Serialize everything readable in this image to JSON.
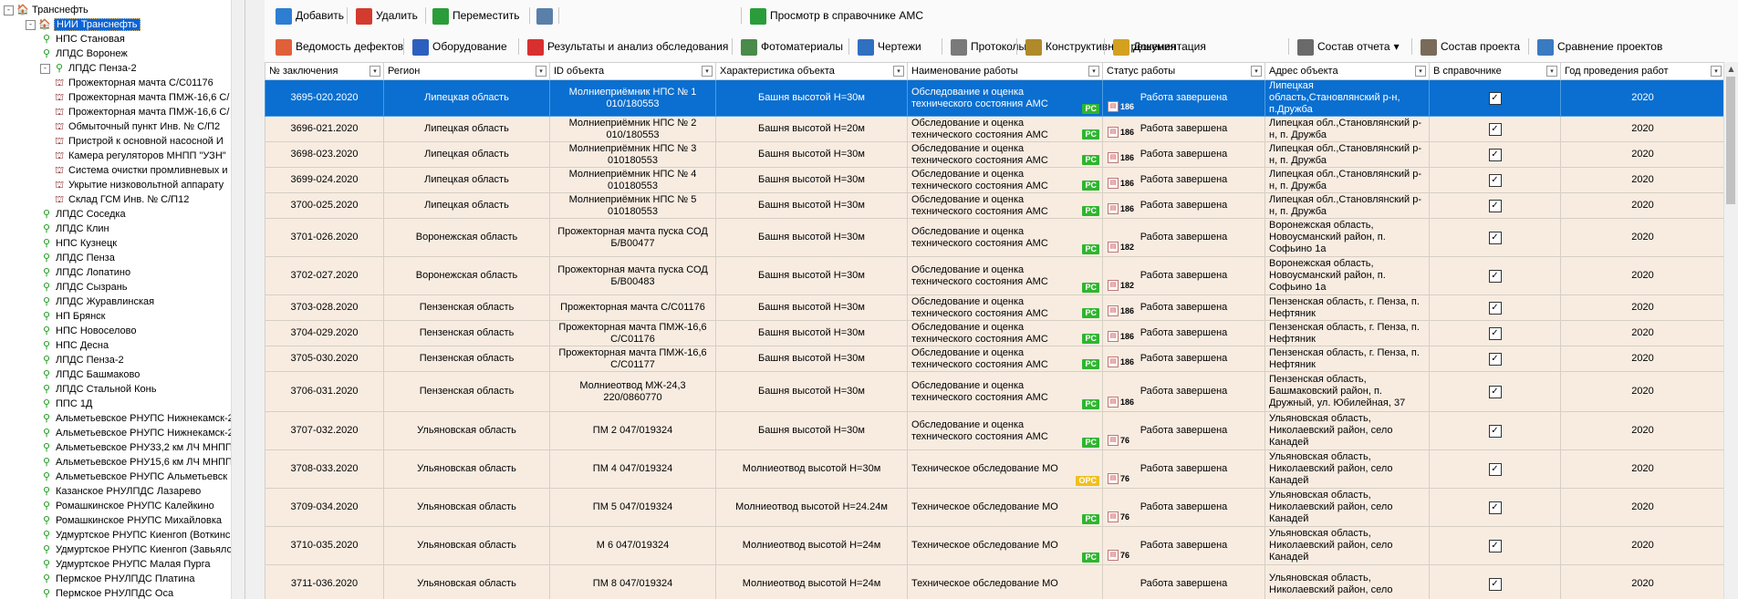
{
  "tree": {
    "items": [
      {
        "label": "Транснефть",
        "level": 0,
        "icon": "building",
        "expander": "-"
      },
      {
        "label": "НИИ Транснефть",
        "level": 1,
        "icon": "building",
        "expander": "-",
        "selected": true
      },
      {
        "label": "НПС Становая",
        "level": 2,
        "icon": "pin"
      },
      {
        "label": "ЛПДС Воронеж",
        "level": 2,
        "icon": "pin"
      },
      {
        "label": "ЛПДС Пенза-2",
        "level": 2,
        "icon": "pin",
        "expander": "-"
      },
      {
        "label": "Прожекторная мачта С/С01176",
        "level": 3,
        "icon": "tower"
      },
      {
        "label": "Прожекторная мачта ПМЖ-16,6 С/",
        "level": 3,
        "icon": "tower"
      },
      {
        "label": "Прожекторная мачта ПМЖ-16,6 С/",
        "level": 3,
        "icon": "tower"
      },
      {
        "label": "Обмыточный пункт   Инв. № С/П2",
        "level": 3,
        "icon": "tower"
      },
      {
        "label": "Пристрой к основной насосной   И",
        "level": 3,
        "icon": "tower"
      },
      {
        "label": "Камера регуляторов МНПП \"УЗН\"",
        "level": 3,
        "icon": "tower"
      },
      {
        "label": "Система очистки промливневых и (",
        "level": 3,
        "icon": "tower"
      },
      {
        "label": "Укрытие низковольтной аппарату",
        "level": 3,
        "icon": "tower"
      },
      {
        "label": "Склад  ГСМ  Инв. № С/П12",
        "level": 3,
        "icon": "tower"
      },
      {
        "label": "ЛПДС Соседка",
        "level": 2,
        "icon": "pin"
      },
      {
        "label": "ЛПДС Клин",
        "level": 2,
        "icon": "pin"
      },
      {
        "label": "НПС Кузнецк",
        "level": 2,
        "icon": "pin"
      },
      {
        "label": "ЛПДС Пенза",
        "level": 2,
        "icon": "pin"
      },
      {
        "label": "ЛПДС Лопатино",
        "level": 2,
        "icon": "pin"
      },
      {
        "label": "ЛПДС Сызрань",
        "level": 2,
        "icon": "pin"
      },
      {
        "label": "ЛПДС Журавлинская",
        "level": 2,
        "icon": "pin"
      },
      {
        "label": "НП Брянск",
        "level": 2,
        "icon": "pin"
      },
      {
        "label": "НПС Новоселово",
        "level": 2,
        "icon": "pin"
      },
      {
        "label": "НПС Десна",
        "level": 2,
        "icon": "pin"
      },
      {
        "label": "ЛПДС Пенза-2",
        "level": 2,
        "icon": "pin"
      },
      {
        "label": "ЛПДС Башмаково",
        "level": 2,
        "icon": "pin"
      },
      {
        "label": "ЛПДС Стальной Конь",
        "level": 2,
        "icon": "pin"
      },
      {
        "label": "ППС 1Д",
        "level": 2,
        "icon": "pin"
      },
      {
        "label": "Альметьевское РНУПС Нижнекамск-2",
        "level": 2,
        "icon": "pin"
      },
      {
        "label": "Альметьевское РНУПС Нижнекамск-2",
        "level": 2,
        "icon": "pin"
      },
      {
        "label": "Альметьевское РНУ33,2 км ЛЧ МНПП Н",
        "level": 2,
        "icon": "pin"
      },
      {
        "label": "Альметьевское РНУ15,6 км ЛЧ МНПП Н",
        "level": 2,
        "icon": "pin"
      },
      {
        "label": "Альметьевское РНУПС Альметьевск",
        "level": 2,
        "icon": "pin"
      },
      {
        "label": "Казанское РНУЛПДС Лазарево",
        "level": 2,
        "icon": "pin"
      },
      {
        "label": "Ромашкинское РНУПС Калейкино",
        "level": 2,
        "icon": "pin"
      },
      {
        "label": "Ромашкинское РНУПС Михайловка",
        "level": 2,
        "icon": "pin"
      },
      {
        "label": "Удмуртское РНУПС Киенгоп (Воткинс",
        "level": 2,
        "icon": "pin"
      },
      {
        "label": "Удмуртское РНУПС Киенгоп (Завьяло",
        "level": 2,
        "icon": "pin"
      },
      {
        "label": "Удмуртское РНУПС Малая Пурга",
        "level": 2,
        "icon": "pin"
      },
      {
        "label": "Пермское РНУЛПДС Платина",
        "level": 2,
        "icon": "pin"
      },
      {
        "label": "Пермское РНУЛПДС Оса",
        "level": 2,
        "icon": "pin"
      }
    ]
  },
  "toolbar1": [
    {
      "label": "Добавить",
      "icon": "add-doc-icon",
      "color": "#2d7dd2"
    },
    {
      "label": "Удалить",
      "icon": "delete-doc-icon",
      "color": "#d23b2d"
    },
    {
      "label": "Переместить",
      "icon": "move-icon",
      "color": "#2a9d3a"
    },
    {
      "label": "",
      "icon": "view-icon",
      "color": "#5a7fa8"
    },
    {
      "label": "Просмотр в справочнике АМС",
      "icon": "reference-icon",
      "color": "#2a9d3a"
    }
  ],
  "toolbar2": [
    {
      "label": "Ведомость дефектов",
      "icon": "defects-icon",
      "color": "#e0603a"
    },
    {
      "label": "Оборудование",
      "icon": "equipment-icon",
      "color": "#2d5fbf"
    },
    {
      "label": "Результаты и анализ обследования",
      "icon": "results-icon",
      "color": "#d83030"
    },
    {
      "label": "Фотоматериалы",
      "icon": "photo-icon",
      "color": "#4a8a4a"
    },
    {
      "label": "Чертежи",
      "icon": "drawings-icon",
      "color": "#3070c0"
    },
    {
      "label": "Протоколы",
      "icon": "protocols-icon",
      "color": "#7a7a7a"
    },
    {
      "label": "Конструктивные решения",
      "icon": "design-icon",
      "color": "#b08a2a"
    },
    {
      "label": "Документация",
      "icon": "docs-icon",
      "color": "#d4a020"
    },
    {
      "label": "Состав отчета",
      "icon": "report-icon",
      "color": "#6a6a6a",
      "dropdown": "▾"
    },
    {
      "label": "Состав проекта",
      "icon": "project-icon",
      "color": "#7a6a5a"
    },
    {
      "label": "Сравнение проектов",
      "icon": "compare-icon",
      "color": "#3a7ac0"
    }
  ],
  "columns": [
    "№ заключения",
    "Регион",
    "ID объекта",
    "Характеристика объекта",
    "Наименование работы",
    "Статус работы",
    "Адрес объекта",
    "В справочнике",
    "Год проведения работ"
  ],
  "colors": {
    "selection": "#0a6fd0",
    "row": "#f8ece1",
    "badge_pc": "#2fb52f",
    "badge_opc": "#f0c020"
  },
  "rows": [
    {
      "no": "3695-020.2020",
      "region": "Липецкая область",
      "id": "Молниеприёмник НПС  № 1\n010/180553",
      "char": "Башня высотой Н=30м",
      "work": "Обследование и оценка технического состояния АМС",
      "badge": "PC",
      "num": "186",
      "status": "Работа завершена",
      "addr": "Липецкая область,Становлянский р-н, п.Дружба",
      "check": "✓",
      "year": "2020",
      "h": 36,
      "sel": true
    },
    {
      "no": "3696-021.2020",
      "region": "Липецкая область",
      "id": "Молниеприёмник НПС  № 2\n010/180553",
      "char": "Башня высотой Н=20м",
      "work": "Обследование и оценка технического состояния АМС",
      "badge": "PC",
      "num": "186",
      "status": "Работа завершена",
      "addr": "Липецкая обл.,Становлянский р-н, п. Дружба",
      "check": "✓",
      "year": "2020",
      "h": 28
    },
    {
      "no": "3698-023.2020",
      "region": "Липецкая область",
      "id": "Молниеприёмник НПС  № 3\n010180553",
      "char": "Башня высотой Н=30м",
      "work": "Обследование и оценка технического состояния АМС",
      "badge": "PC",
      "num": "186",
      "status": "Работа завершена",
      "addr": "Липецкая обл.,Становлянский р-н, п. Дружба",
      "check": "✓",
      "year": "2020",
      "h": 28
    },
    {
      "no": "3699-024.2020",
      "region": "Липецкая область",
      "id": "Молниеприёмник НПС  № 4\n010180553",
      "char": "Башня высотой Н=30м",
      "work": "Обследование и оценка технического состояния АМС",
      "badge": "PC",
      "num": "186",
      "status": "Работа завершена",
      "addr": "Липецкая обл.,Становлянский р-н, п. Дружба",
      "check": "✓",
      "year": "2020",
      "h": 28
    },
    {
      "no": "3700-025.2020",
      "region": "Липецкая область",
      "id": "Молниеприёмник НПС  № 5\n010180553",
      "char": "Башня высотой Н=30м",
      "work": "Обследование и оценка технического состояния АМС",
      "badge": "PC",
      "num": "186",
      "status": "Работа завершена",
      "addr": "Липецкая обл.,Становлянский р-н, п. Дружба",
      "check": "✓",
      "year": "2020",
      "h": 28
    },
    {
      "no": "3701-026.2020",
      "region": "Воронежская область",
      "id": "Прожекторная мачта пуска СОД\nБ/В00477",
      "char": "Башня высотой Н=30м",
      "work": "Обследование и оценка технического состояния АМС",
      "badge": "PC",
      "num": "182",
      "status": "Работа завершена",
      "addr": "Воронежская область, Новоусманский район, п. Софьино 1а",
      "check": "✓",
      "year": "2020",
      "h": 42
    },
    {
      "no": "3702-027.2020",
      "region": "Воронежская область",
      "id": "Прожекторная мачта пуска СОД\nБ/В00483",
      "char": "Башня высотой Н=30м",
      "work": "Обследование и оценка технического состояния АМС",
      "badge": "PC",
      "num": "182",
      "status": "Работа завершена",
      "addr": "Воронежская область, Новоусманский район, п. Софьино 1а",
      "check": "✓",
      "year": "2020",
      "h": 42
    },
    {
      "no": "3703-028.2020",
      "region": "Пензенская область",
      "id": "Прожекторная мачта С/С01176",
      "char": "Башня высотой Н=30м",
      "work": "Обследование и оценка технического состояния АМС",
      "badge": "PC",
      "num": "186",
      "status": "Работа завершена",
      "addr": "Пензенская область, г. Пенза, п. Нефтяник",
      "check": "✓",
      "year": "2020",
      "h": 28
    },
    {
      "no": "3704-029.2020",
      "region": "Пензенская область",
      "id": "Прожекторная мачта ПМЖ-16,6\nС/С01176",
      "char": "Башня высотой Н=30м",
      "work": "Обследование и оценка технического состояния АМС",
      "badge": "PC",
      "num": "186",
      "status": "Работа завершена",
      "addr": "Пензенская область, г. Пенза, п. Нефтяник",
      "check": "✓",
      "year": "2020",
      "h": 28
    },
    {
      "no": "3705-030.2020",
      "region": "Пензенская область",
      "id": "Прожекторная мачта ПМЖ-16,6\nС/С01177",
      "char": "Башня высотой Н=30м",
      "work": "Обследование и оценка технического состояния АМС",
      "badge": "PC",
      "num": "186",
      "status": "Работа завершена",
      "addr": "Пензенская область, г. Пенза, п. Нефтяник",
      "check": "✓",
      "year": "2020",
      "h": 28
    },
    {
      "no": "3706-031.2020",
      "region": "Пензенская область",
      "id": "Молниеотвод МЖ-24,3\n220/0860770",
      "char": "Башня высотой Н=30м",
      "work": "Обследование и оценка технического состояния АМС",
      "badge": "PC",
      "num": "186",
      "status": "Работа завершена",
      "addr": "Пензенская область, Башмаковский район, п. Дружный, ул. Юбилейная, 37",
      "check": "✓",
      "year": "2020",
      "h": 44
    },
    {
      "no": "3707-032.2020",
      "region": "Ульяновская область",
      "id": "ПМ 2 047/019324",
      "char": "Башня высотой Н=30м",
      "work": "Обследование и оценка технического состояния АМС",
      "badge": "PC",
      "num": "76",
      "status": "Работа завершена",
      "addr": "Ульяновская область, Николаевский район, село Канадей",
      "check": "✓",
      "year": "2020",
      "h": 42
    },
    {
      "no": "3708-033.2020",
      "region": "Ульяновская область",
      "id": "ПМ 4 047/019324",
      "char": "Молниеотвод высотой Н=30м",
      "work": "Техническое обследование МО",
      "badge": "OPC",
      "num": "76",
      "status": "Работа завершена",
      "addr": "Ульяновская область, Николаевский район, село Канадей",
      "check": "✓",
      "year": "2020",
      "h": 42
    },
    {
      "no": "3709-034.2020",
      "region": "Ульяновская область",
      "id": "ПМ 5 047/019324",
      "char": "Молниеотвод высотой Н=24.24м",
      "work": "Техническое обследование МО",
      "badge": "PC",
      "num": "76",
      "status": "Работа завершена",
      "addr": "Ульяновская область, Николаевский район, село Канадей",
      "check": "✓",
      "year": "2020",
      "h": 42
    },
    {
      "no": "3710-035.2020",
      "region": "Ульяновская область",
      "id": "М 6 047/019324",
      "char": "Молниеотвод высотой Н=24м",
      "work": "Техническое обследование МО",
      "badge": "PC",
      "num": "76",
      "status": "Работа завершена",
      "addr": "Ульяновская область, Николаевский район, село Канадей",
      "check": "✓",
      "year": "2020",
      "h": 42
    },
    {
      "no": "3711-036.2020",
      "region": "Ульяновская область",
      "id": "ПМ 8 047/019324",
      "char": "Молниеотвод высотой Н=24м",
      "work": "Техническое обследование МО",
      "badge": "",
      "num": "",
      "status": "Работа завершена",
      "addr": "Ульяновская область, Николаевский район, село",
      "check": "✓",
      "year": "2020",
      "h": 42
    }
  ]
}
